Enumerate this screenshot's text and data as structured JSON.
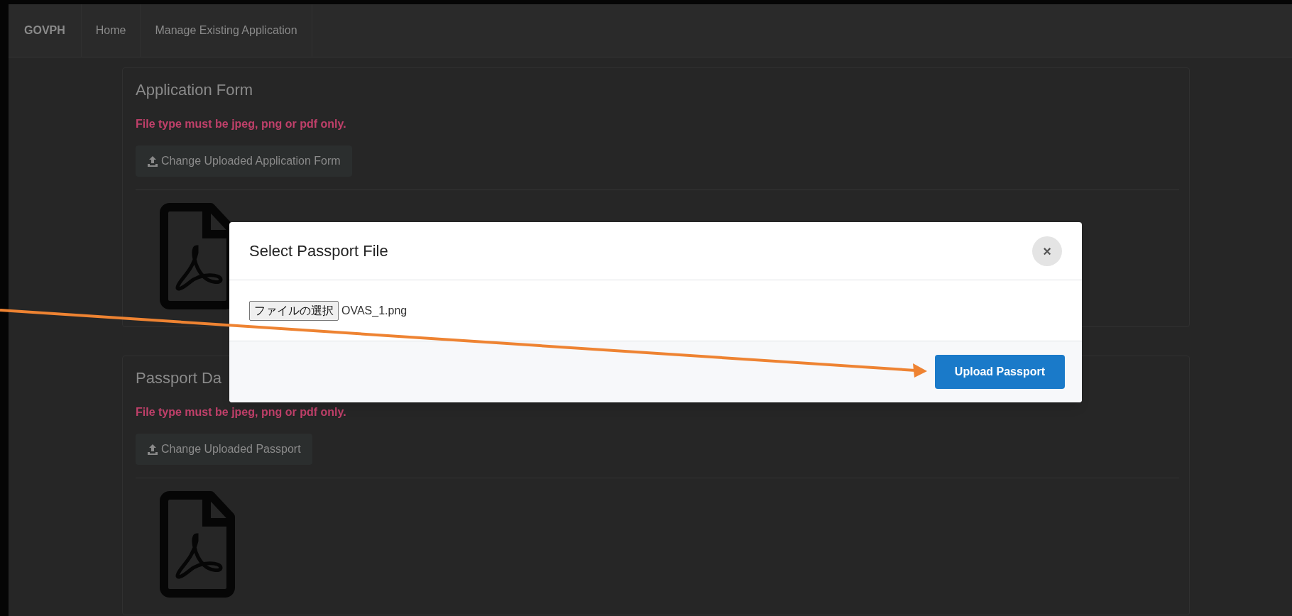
{
  "navbar": {
    "brand": "GOVPH",
    "links": [
      {
        "label": "Home"
      },
      {
        "label": "Manage Existing Application"
      }
    ]
  },
  "cards": [
    {
      "title": "Application Form",
      "note": "File type must be jpeg, png or pdf only.",
      "button": "Change Uploaded Application Form"
    },
    {
      "title": "Passport Da",
      "note": "File type must be jpeg, png or pdf only.",
      "button": "Change Uploaded Passport"
    }
  ],
  "modal": {
    "title": "Select Passport File",
    "close": "×",
    "file_button": "ファイルの選択",
    "file_name": "OVAS_1.png",
    "submit": "Upload Passport"
  }
}
